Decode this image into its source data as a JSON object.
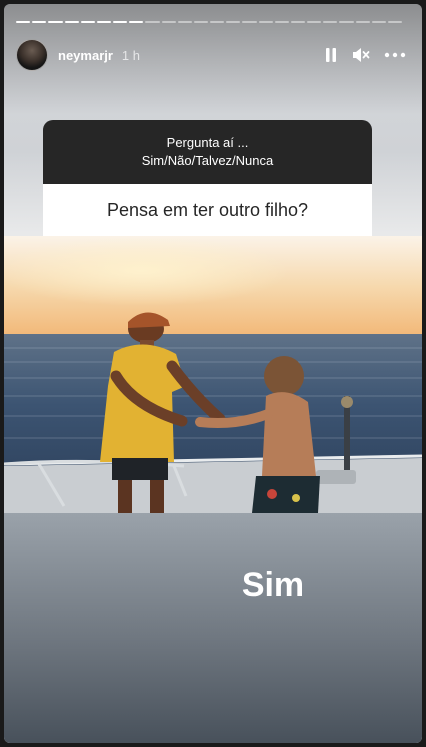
{
  "story": {
    "progress": {
      "total_segments": 24,
      "completed_segments": 8
    },
    "user": {
      "username": "neymarjr",
      "time": "1 h"
    },
    "controls": [
      "pause-icon",
      "mute-icon",
      "more-icon"
    ]
  },
  "question_sticker": {
    "header_line1": "Pergunta aí ...",
    "header_line2": "Sim/Não/Talvez/Nunca",
    "question": "Pensa em ter outro filho?"
  },
  "answer": "Sim",
  "colors": {
    "sticker_header": "#262626",
    "sticker_body": "#ffffff",
    "shirt_yellow": "#e2b232"
  }
}
